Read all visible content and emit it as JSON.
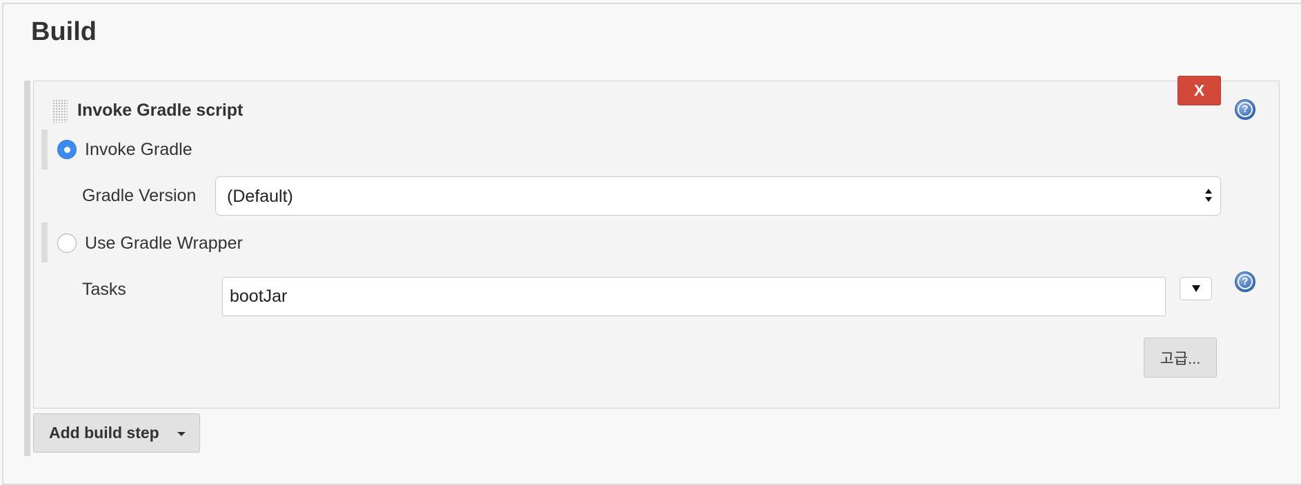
{
  "section": {
    "title": "Build"
  },
  "build_step": {
    "title": "Invoke Gradle script",
    "delete_label": "X",
    "help_symbol": "?",
    "options": [
      {
        "label": "Invoke Gradle",
        "selected": true
      },
      {
        "label": "Use Gradle Wrapper",
        "selected": false
      }
    ],
    "gradle_version": {
      "label": "Gradle Version",
      "value": "(Default)"
    },
    "tasks": {
      "label": "Tasks",
      "value": "bootJar",
      "expand_icon": "triangle-down-icon"
    },
    "advanced_label": "고급..."
  },
  "add_build_step": {
    "label": "Add build step",
    "icon": "caret-down-icon"
  },
  "colors": {
    "delete_button": "#d24939",
    "radio_selected": "#3d8bf0",
    "help_icon": "#3a6db8",
    "background": "#f8f8f8"
  }
}
